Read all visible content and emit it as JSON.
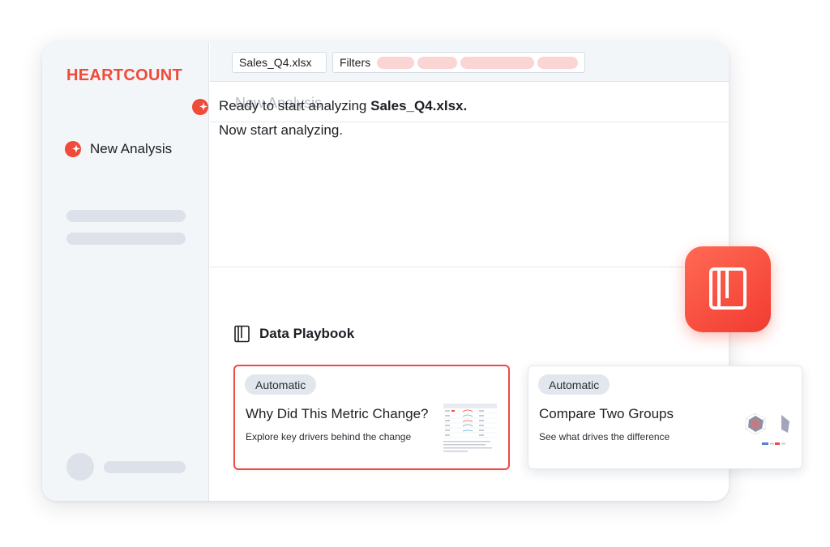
{
  "sidebar": {
    "logo": "HEARTCOUNT",
    "nav": [
      {
        "label": "New Analysis",
        "icon": "heartcount-spark-icon"
      }
    ]
  },
  "topbar": {
    "file_chip": "Sales_Q4.xlsx",
    "filters_label": "Filters",
    "filter_pill_count": 4
  },
  "main": {
    "section_title": "New Analysis",
    "message": {
      "line1_prefix": "Ready to start analyzing ",
      "line1_file": "Sales_Q4.xlsx.",
      "line2": "Now start analyzing."
    },
    "playbook": {
      "title": "Data Playbook",
      "icon": "book-icon",
      "cards": [
        {
          "badge": "Automatic",
          "title": "Why Did This Metric Change?",
          "description": "Explore key drivers behind the change",
          "selected": true,
          "thumbnail": "table-thumbnail"
        },
        {
          "badge": "Automatic",
          "title": "Compare Two Groups",
          "description": "See what drives the difference",
          "selected": false,
          "thumbnail": "radar-thumbnail"
        }
      ]
    }
  },
  "colors": {
    "brand": "#f04a38",
    "selected_border": "#ef4a44",
    "filter_pill": "#fbd4d4",
    "skeleton": "#dde2ea"
  },
  "app_badge": {
    "icon": "book-icon"
  }
}
